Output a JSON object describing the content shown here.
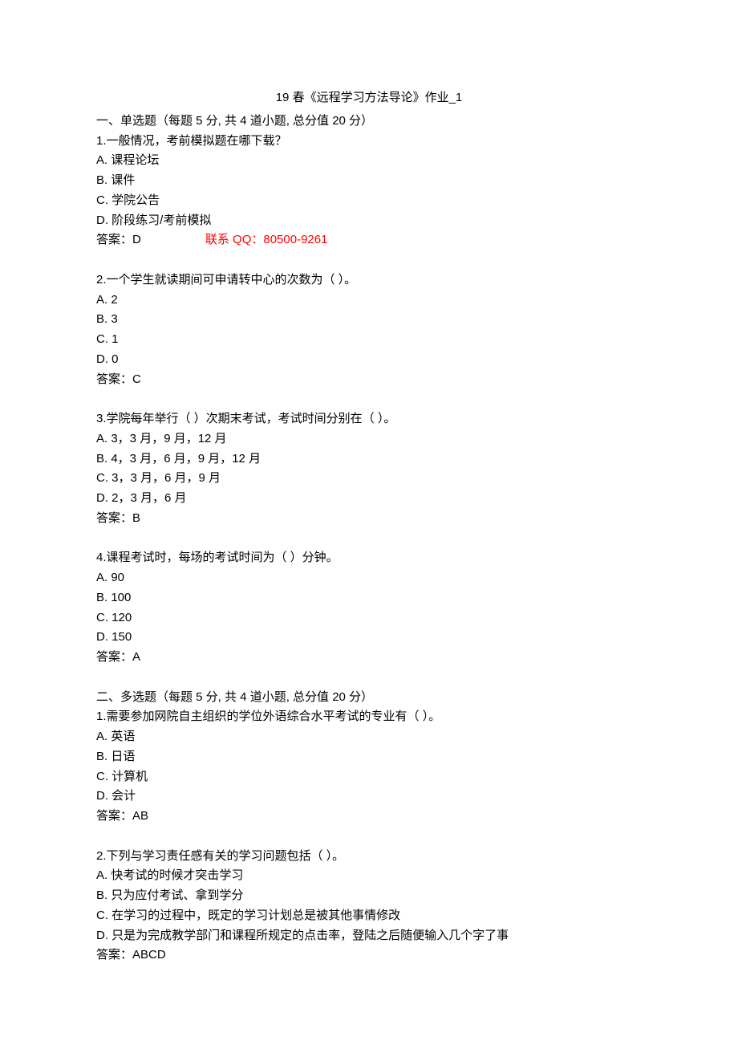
{
  "title": "19 春《远程学习方法导论》作业_1",
  "sections": [
    {
      "header": "一、单选题（每题 5 分, 共 4 道小题, 总分值 20 分）",
      "questions": [
        {
          "stem": "1.一般情况，考前模拟题在哪下载？",
          "options": [
            "A. 课程论坛",
            "B. 课件",
            "C. 学院公告",
            "D. 阶段练习/考前模拟"
          ],
          "answer_label": "答案：",
          "answer": "D",
          "contact": "联系 QQ：80500-9261"
        },
        {
          "stem": "2.一个学生就读期间可申请转中心的次数为（ ）。",
          "options": [
            "A. 2",
            "B. 3",
            "C. 1",
            "D. 0"
          ],
          "answer_label": "答案：",
          "answer": "C"
        },
        {
          "stem": "3.学院每年举行（ ）次期末考试，考试时间分别在（ ）。",
          "options": [
            "A. 3，3 月，9 月，12 月",
            "B. 4，3 月，6 月，9 月，12 月",
            "C. 3，3 月，6 月，9 月",
            "D. 2，3 月，6 月"
          ],
          "answer_label": "答案：",
          "answer": "B"
        },
        {
          "stem": "4.课程考试时，每场的考试时间为（ ）分钟。",
          "options": [
            "A. 90",
            "B. 100",
            "C. 120",
            "D. 150"
          ],
          "answer_label": "答案：",
          "answer": "A"
        }
      ]
    },
    {
      "header": "二、多选题（每题 5 分, 共 4 道小题, 总分值 20 分）",
      "questions": [
        {
          "stem": "1.需要参加网院自主组织的学位外语综合水平考试的专业有（ ）。",
          "options": [
            "A. 英语",
            "B. 日语",
            "C. 计算机",
            "D. 会计"
          ],
          "answer_label": "答案：",
          "answer": "AB"
        },
        {
          "stem": "2.下列与学习责任感有关的学习问题包括（ ）。",
          "options": [
            "A. 快考试的时候才突击学习",
            "B. 只为应付考试、拿到学分",
            "C. 在学习的过程中，既定的学习计划总是被其他事情修改",
            "D. 只是为完成教学部门和课程所规定的点击率，登陆之后随便输入几个字了事"
          ],
          "answer_label": "答案：",
          "answer": "ABCD"
        }
      ]
    }
  ]
}
